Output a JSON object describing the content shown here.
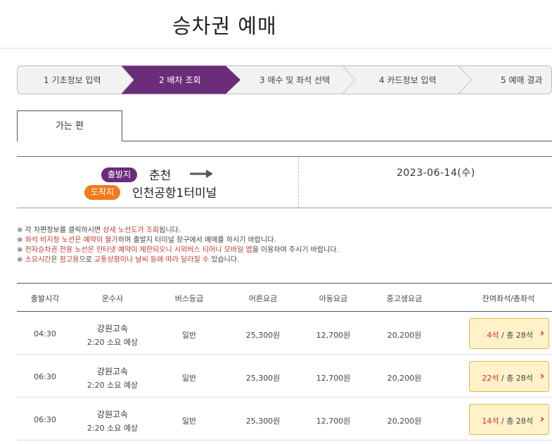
{
  "page": {
    "title": "승차권 예매"
  },
  "steps": [
    {
      "label": "1 기초정보 입력",
      "active": false
    },
    {
      "label": "2 배차 조회",
      "active": true
    },
    {
      "label": "3 매수 및 좌석 선택",
      "active": false
    },
    {
      "label": "4 카드정보 입력",
      "active": false
    },
    {
      "label": "5 예매 결과",
      "active": false
    }
  ],
  "tab": {
    "label": "가는 편"
  },
  "route": {
    "departure_badge": "출발지",
    "departure": "춘천",
    "arrival_badge": "도착지",
    "arrival": "인천공항1터미널",
    "date": "2023-06-14(수)"
  },
  "notices": [
    {
      "pre": "※ 각 차편정보를 클릭하시면 ",
      "hl": "상세 노선도가 조회",
      "post": "됩니다."
    },
    {
      "pre": "※ ",
      "hl": "좌석 비지정 노선은 예약이 불가",
      "post": "하며 출발지 터미널 창구에서 예매를 하시기 바랍니다."
    },
    {
      "pre": "※ ",
      "hl": "전자승차권 전용 노선은 인터넷 예약이 제한되오니 시외버스 티머니 모바일 앱",
      "post": "을 이용하여 주시기 바랍니다."
    },
    {
      "pre": "※ ",
      "hl": "소요시간",
      "post": "은 ",
      "hl2": "참고용",
      "post2": "으로 ",
      "hl3": "교통상황이나 날씨 등에 따라 달라질 수",
      "post3": " 있습니다."
    }
  ],
  "table": {
    "headers": [
      "출발시각",
      "운수사",
      "버스등급",
      "어른요금",
      "아동요금",
      "중고생요금",
      "잔여좌석/총좌석"
    ],
    "rows": [
      {
        "time": "04:30",
        "company": "강원고속",
        "duration": "2:20 소요 예상",
        "grade": "일반",
        "adult": "25,300원",
        "child": "12,700원",
        "student": "20,200원",
        "remaining": "4석",
        "sep": " / 총 ",
        "total": "28석"
      },
      {
        "time": "06:30",
        "company": "강원고속",
        "duration": "2:20 소요 예상",
        "grade": "일반",
        "adult": "25,300원",
        "child": "12,700원",
        "student": "20,200원",
        "remaining": "22석",
        "sep": " / 총 ",
        "total": "28석"
      },
      {
        "time": "06:30",
        "company": "강원고속",
        "duration": "2:20 소요 예상",
        "grade": "일반",
        "adult": "25,300원",
        "child": "12,700원",
        "student": "20,200원",
        "remaining": "14석",
        "sep": " / 총 ",
        "total": "28석"
      }
    ]
  },
  "colors": {
    "accent_purple": "#6b2c7a",
    "arrival_orange": "#f07c1e",
    "highlight_red": "#c0392b",
    "seat_button_bg": "#fff2c8"
  },
  "icons": {
    "route_arrow": "arrow-right-icon",
    "seat_chevron": "chevron-right-icon"
  }
}
